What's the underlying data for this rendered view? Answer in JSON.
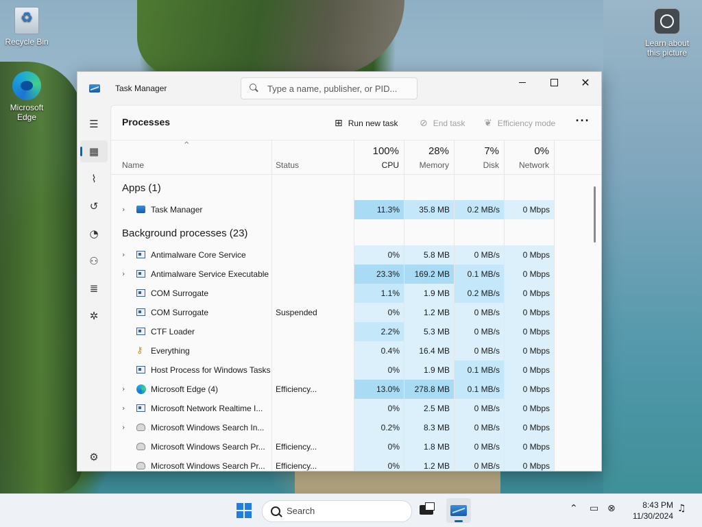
{
  "desktop": {
    "icons": [
      {
        "label": "Recycle Bin"
      },
      {
        "label": "Microsoft Edge"
      },
      {
        "label": "Learn about this picture"
      }
    ]
  },
  "window": {
    "title": "Task Manager",
    "search_placeholder": "Type a name, publisher, or PID...",
    "controls": {
      "minimize": "—",
      "maximize": "□",
      "close": "✕"
    }
  },
  "page": {
    "title": "Processes",
    "commands": {
      "run_new_task": "Run new task",
      "end_task": "End task",
      "efficiency_mode": "Efficiency mode",
      "more": "···"
    }
  },
  "columns": {
    "name": "Name",
    "status": "Status",
    "cpu": {
      "pct": "100%",
      "label": "CPU"
    },
    "memory": {
      "pct": "28%",
      "label": "Memory"
    },
    "disk": {
      "pct": "7%",
      "label": "Disk"
    },
    "network": {
      "pct": "0%",
      "label": "Network"
    }
  },
  "groups": {
    "apps": "Apps (1)",
    "background": "Background processes (23)"
  },
  "apps": [
    {
      "name": "Task Manager",
      "status": "",
      "cpu": "11.3%",
      "memory": "35.8 MB",
      "disk": "0.2 MB/s",
      "network": "0 Mbps",
      "icon": "task-manager-icon",
      "expandable": true
    }
  ],
  "processes": [
    {
      "name": "Antimalware Core Service",
      "status": "",
      "cpu": "0%",
      "memory": "5.8 MB",
      "disk": "0 MB/s",
      "network": "0 Mbps",
      "icon": "process-icon",
      "expandable": true
    },
    {
      "name": "Antimalware Service Executable",
      "status": "",
      "cpu": "23.3%",
      "memory": "169.2 MB",
      "disk": "0.1 MB/s",
      "network": "0 Mbps",
      "icon": "process-icon",
      "expandable": true
    },
    {
      "name": "COM Surrogate",
      "status": "",
      "cpu": "1.1%",
      "memory": "1.9 MB",
      "disk": "0.2 MB/s",
      "network": "0 Mbps",
      "icon": "process-icon",
      "expandable": false
    },
    {
      "name": "COM Surrogate",
      "status": "Suspended",
      "cpu": "0%",
      "memory": "1.2 MB",
      "disk": "0 MB/s",
      "network": "0 Mbps",
      "icon": "process-icon",
      "expandable": false
    },
    {
      "name": "CTF Loader",
      "status": "",
      "cpu": "2.2%",
      "memory": "5.3 MB",
      "disk": "0 MB/s",
      "network": "0 Mbps",
      "icon": "process-icon",
      "expandable": false
    },
    {
      "name": "Everything",
      "status": "",
      "cpu": "0.4%",
      "memory": "16.4 MB",
      "disk": "0 MB/s",
      "network": "0 Mbps",
      "icon": "key-icon",
      "expandable": false
    },
    {
      "name": "Host Process for Windows Tasks",
      "status": "",
      "cpu": "0%",
      "memory": "1.9 MB",
      "disk": "0.1 MB/s",
      "network": "0 Mbps",
      "icon": "process-icon",
      "expandable": false
    },
    {
      "name": "Microsoft Edge (4)",
      "status": "Efficiency...",
      "cpu": "13.0%",
      "memory": "278.8 MB",
      "disk": "0.1 MB/s",
      "network": "0 Mbps",
      "icon": "edge-icon",
      "expandable": true
    },
    {
      "name": "Microsoft Network Realtime I...",
      "status": "",
      "cpu": "0%",
      "memory": "2.5 MB",
      "disk": "0 MB/s",
      "network": "0 Mbps",
      "icon": "process-icon",
      "expandable": true
    },
    {
      "name": "Microsoft Windows Search In...",
      "status": "",
      "cpu": "0.2%",
      "memory": "8.3 MB",
      "disk": "0 MB/s",
      "network": "0 Mbps",
      "icon": "user-icon",
      "expandable": true
    },
    {
      "name": "Microsoft Windows Search Pr...",
      "status": "Efficiency...",
      "cpu": "0%",
      "memory": "1.8 MB",
      "disk": "0 MB/s",
      "network": "0 Mbps",
      "icon": "user-icon",
      "expandable": false
    },
    {
      "name": "Microsoft Windows Search Pr...",
      "status": "Efficiency...",
      "cpu": "0%",
      "memory": "1.2 MB",
      "disk": "0 MB/s",
      "network": "0 Mbps",
      "icon": "user-icon",
      "expandable": false
    }
  ],
  "heat_colors": {
    "low": "#dcf0fb",
    "mid": "#c4e7f9",
    "high": "#a9dbf5",
    "header_disk": "#8fd0f2"
  },
  "taskbar": {
    "search_label": "Search",
    "time": "8:43 PM",
    "date": "11/30/2024"
  }
}
